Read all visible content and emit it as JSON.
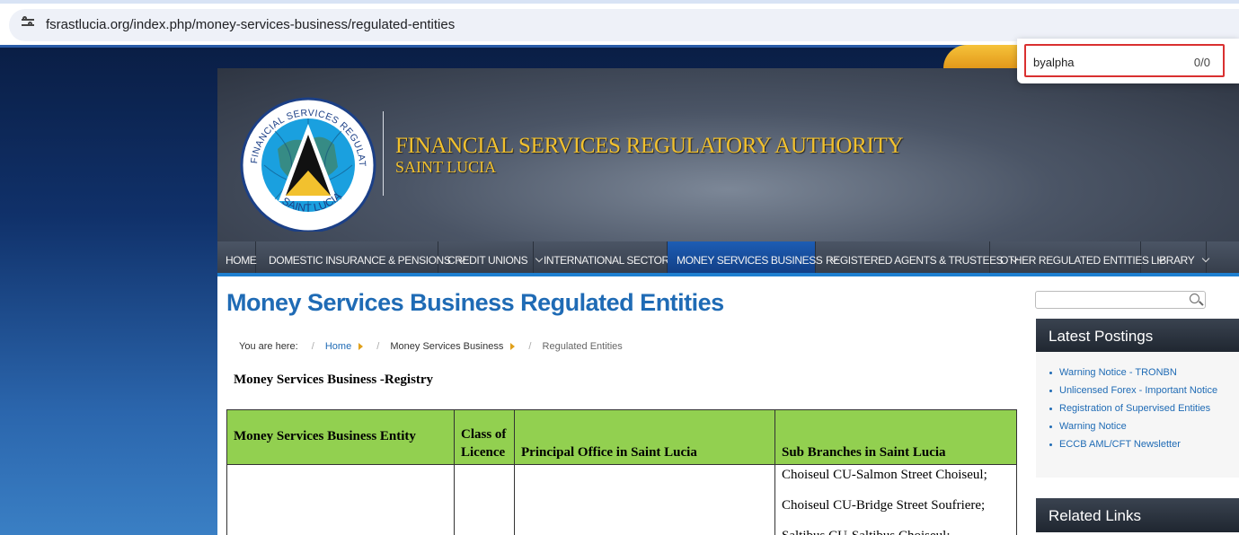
{
  "browser": {
    "url": "fsrastlucia.org/index.php/money-services-business/regulated-entities",
    "find": {
      "query": "byalpha",
      "count": "0/0"
    }
  },
  "header": {
    "title": "FINANCIAL SERVICES  REGULATORY AUTHORITY",
    "subtitle": "SAINT LUCIA",
    "logo_ring_text": "FINANCIAL SERVICES REGULATORY AUTHORITY",
    "logo_bottom_text": "SAINT LUCIA"
  },
  "nav": {
    "items": [
      {
        "label": "HOME",
        "dropdown": false
      },
      {
        "label": "DOMESTIC INSURANCE & PENSIONS",
        "dropdown": true
      },
      {
        "label": "CREDIT UNIONS",
        "dropdown": true
      },
      {
        "label": "INTERNATIONAL SECTOR",
        "dropdown": true
      },
      {
        "label": "MONEY SERVICES BUSINESS",
        "dropdown": true,
        "active": true
      },
      {
        "label": "REGISTERED AGENTS & TRUSTEES",
        "dropdown": true
      },
      {
        "label": "OTHER REGULATED ENTITIES",
        "dropdown": true
      },
      {
        "label": "LIBRARY",
        "dropdown": true
      }
    ]
  },
  "main": {
    "title": "Money Services Business Regulated Entities",
    "breadcrumb": {
      "prefix": "You are here:",
      "items": [
        "Home",
        "Money Services Business",
        "Regulated Entities"
      ]
    },
    "registry_heading": "Money Services Business -Registry",
    "table": {
      "headers": [
        "Money Services Business Entity",
        "Class of Licence",
        "Principal Office in Saint Lucia",
        "Sub Branches in Saint Lucia"
      ],
      "sub_branches": [
        "Choiseul CU-Salmon Street Choiseul;",
        "Choiseul CU-Bridge Street Soufriere;",
        "Saltibus CU-Saltibus Choiseul;"
      ]
    }
  },
  "sidebar": {
    "latest_postings_title": "Latest Postings",
    "latest_postings": [
      "Warning Notice - TRONBN",
      "Unlicensed Forex - Important Notice",
      "Registration of Supervised Entities",
      "Warning Notice",
      "ECCB AML/CFT Newsletter"
    ],
    "related_links_title": "Related Links"
  }
}
